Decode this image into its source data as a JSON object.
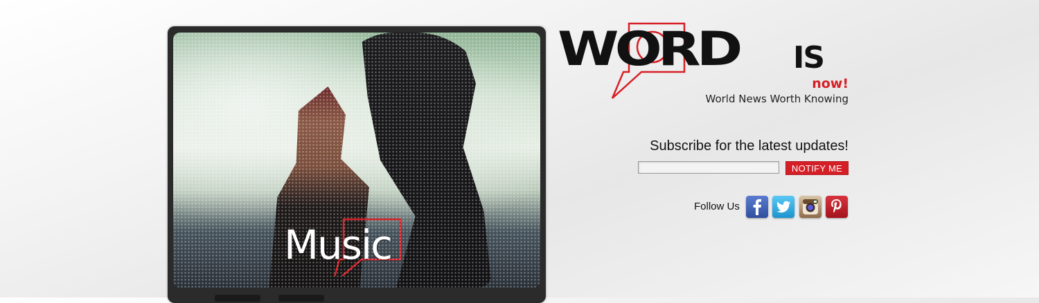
{
  "slideshow": {
    "caption": "Music"
  },
  "logo": {
    "word": "WORD",
    "is": "IS",
    "now": "now!",
    "tagline": "World News Worth Knowing",
    "accent_color": "#d61f26"
  },
  "subscribe": {
    "heading": "Subscribe for the latest updates!",
    "email_value": "",
    "button_label": "NOTIFY ME",
    "button_color": "#d51f27"
  },
  "social": {
    "label": "Follow Us",
    "networks": [
      {
        "icon": "facebook-icon",
        "color": "#3b5998"
      },
      {
        "icon": "twitter-icon",
        "color": "#1da1f2"
      },
      {
        "icon": "instagram-icon",
        "color": "#8e6a4a"
      },
      {
        "icon": "pinterest-icon",
        "color": "#bd081c"
      }
    ]
  }
}
